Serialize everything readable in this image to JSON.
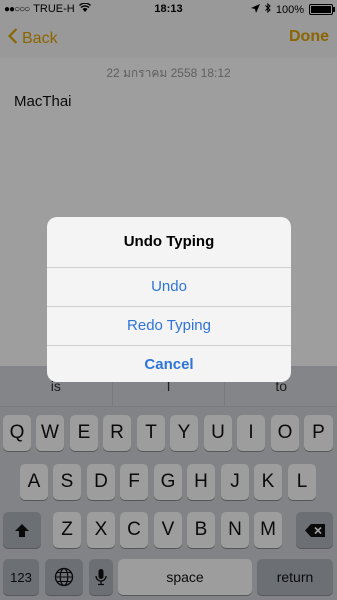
{
  "status_bar": {
    "carrier": "TRUE-H",
    "time": "18:13",
    "battery": "100%",
    "battery_level": 1.0,
    "signal_icon": "signal-dots-icon",
    "wifi_icon": "wifi-icon",
    "location_icon": "location-arrow-icon",
    "bluetooth_icon": "bluetooth-icon"
  },
  "nav": {
    "back_label": "Back",
    "done_label": "Done",
    "accent_color": "#e0a400"
  },
  "note": {
    "date": "22 มกราคม 2558 18:12",
    "text": "MacThai"
  },
  "keyboard": {
    "suggestions": [
      "is",
      "I",
      "to"
    ],
    "row1": [
      "Q",
      "W",
      "E",
      "R",
      "T",
      "Y",
      "U",
      "I",
      "O",
      "P"
    ],
    "row2": [
      "A",
      "S",
      "D",
      "F",
      "G",
      "H",
      "J",
      "K",
      "L"
    ],
    "row3": [
      "Z",
      "X",
      "C",
      "V",
      "B",
      "N",
      "M"
    ],
    "num_label": "123",
    "space_label": "space",
    "return_label": "return"
  },
  "alert": {
    "title": "Undo Typing",
    "buttons": [
      "Undo",
      "Redo Typing",
      "Cancel"
    ],
    "button_color": "#2f74d8"
  }
}
